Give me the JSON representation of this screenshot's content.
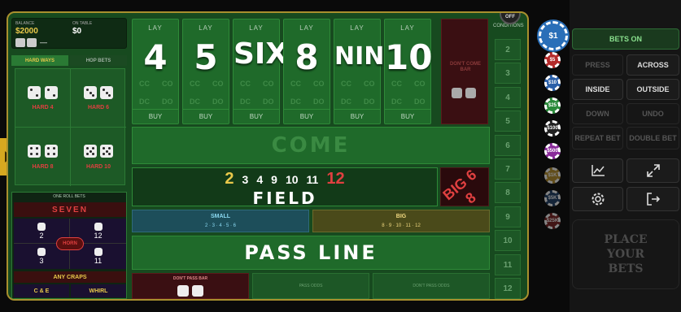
{
  "balance": {
    "label": "BALANCE",
    "value": "$2000",
    "on_table_label": "ON TABLE",
    "on_table_value": "$0",
    "dash": "—"
  },
  "off_label": "OFF",
  "numbers": [
    {
      "lay": "LAY",
      "label": "4",
      "c1": "CC",
      "c2": "CO",
      "c3": "DC",
      "c4": "DO",
      "buy": "BUY"
    },
    {
      "lay": "LAY",
      "label": "5",
      "c1": "CC",
      "c2": "CO",
      "c3": "DC",
      "c4": "DO",
      "buy": "BUY"
    },
    {
      "lay": "LAY",
      "label": "SIX",
      "c1": "CC",
      "c2": "CO",
      "c3": "DC",
      "c4": "DO",
      "buy": "BUY"
    },
    {
      "lay": "LAY",
      "label": "8",
      "c1": "CC",
      "c2": "CO",
      "c3": "DC",
      "c4": "DO",
      "buy": "BUY"
    },
    {
      "lay": "LAY",
      "label": "NINE",
      "c1": "CC",
      "c2": "CO",
      "c3": "DC",
      "c4": "DO",
      "buy": "BUY"
    },
    {
      "lay": "LAY",
      "label": "10",
      "c1": "CC",
      "c2": "CO",
      "c3": "DC",
      "c4": "DO",
      "buy": "BUY"
    }
  ],
  "dont_come": "DON'T COME BAR",
  "with_conditions": "WITH CONDITIONS",
  "conditions": [
    "2",
    "3",
    "4",
    "5",
    "6",
    "7",
    "8",
    "9",
    "10",
    "11",
    "12"
  ],
  "tabs": {
    "hard_ways": "HARD WAYS",
    "hop_bets": "HOP BETS"
  },
  "hardways": [
    "HARD 4",
    "HARD 6",
    "HARD 8",
    "HARD 10"
  ],
  "come": "COME",
  "field": {
    "label": "FIELD",
    "nums": [
      "2",
      "3",
      "4",
      "9",
      "10",
      "11",
      "12"
    ]
  },
  "big68": "BIG 6 8",
  "one_roll": {
    "title": "ONE ROLL BETS",
    "seven": "SEVEN",
    "horn": "HORN",
    "n2": "2",
    "n12": "12",
    "n3": "3",
    "n11": "11",
    "any_craps": "ANY CRAPS",
    "ce": "C & E",
    "whirl": "WHIRL"
  },
  "small": {
    "label": "SMALL",
    "nums": "2 · 3 · 4 · 5 · 6"
  },
  "big": {
    "label": "BIG",
    "nums": "8 · 9 · 10 · 11 · 12"
  },
  "pass_line": "PASS LINE",
  "dont_pass_bar": "DON'T PASS BAR",
  "pass_odds": "PASS ODDS",
  "dont_pass_odds": "DON'T PASS ODDS",
  "chips": [
    {
      "label": "$1",
      "color": "#2a6fb8"
    },
    {
      "label": "$5",
      "color": "#b32a2a"
    },
    {
      "label": "$10",
      "color": "#2a5fa8"
    },
    {
      "label": "$25",
      "color": "#2a8a3a"
    },
    {
      "label": "$100",
      "color": "#222222"
    },
    {
      "label": "$500",
      "color": "#8a2a9a"
    },
    {
      "label": "$1K",
      "color": "#b8902a"
    },
    {
      "label": "$5K",
      "color": "#1f3f66"
    },
    {
      "label": "$25K",
      "color": "#7a2020"
    }
  ],
  "controls": {
    "bets_on": "BETS ON",
    "press": "PRESS",
    "across": "ACROSS",
    "inside": "INSIDE",
    "outside": "OUTSIDE",
    "down": "DOWN",
    "undo": "UNDO",
    "repeat": "REPEAT BET",
    "double": "DOUBLE BET",
    "place": "PLACE YOUR BETS"
  },
  "colors": {
    "felt": "#174a1f",
    "gold": "#a8902e",
    "red": "#e04040",
    "yellow": "#e8c84a"
  }
}
